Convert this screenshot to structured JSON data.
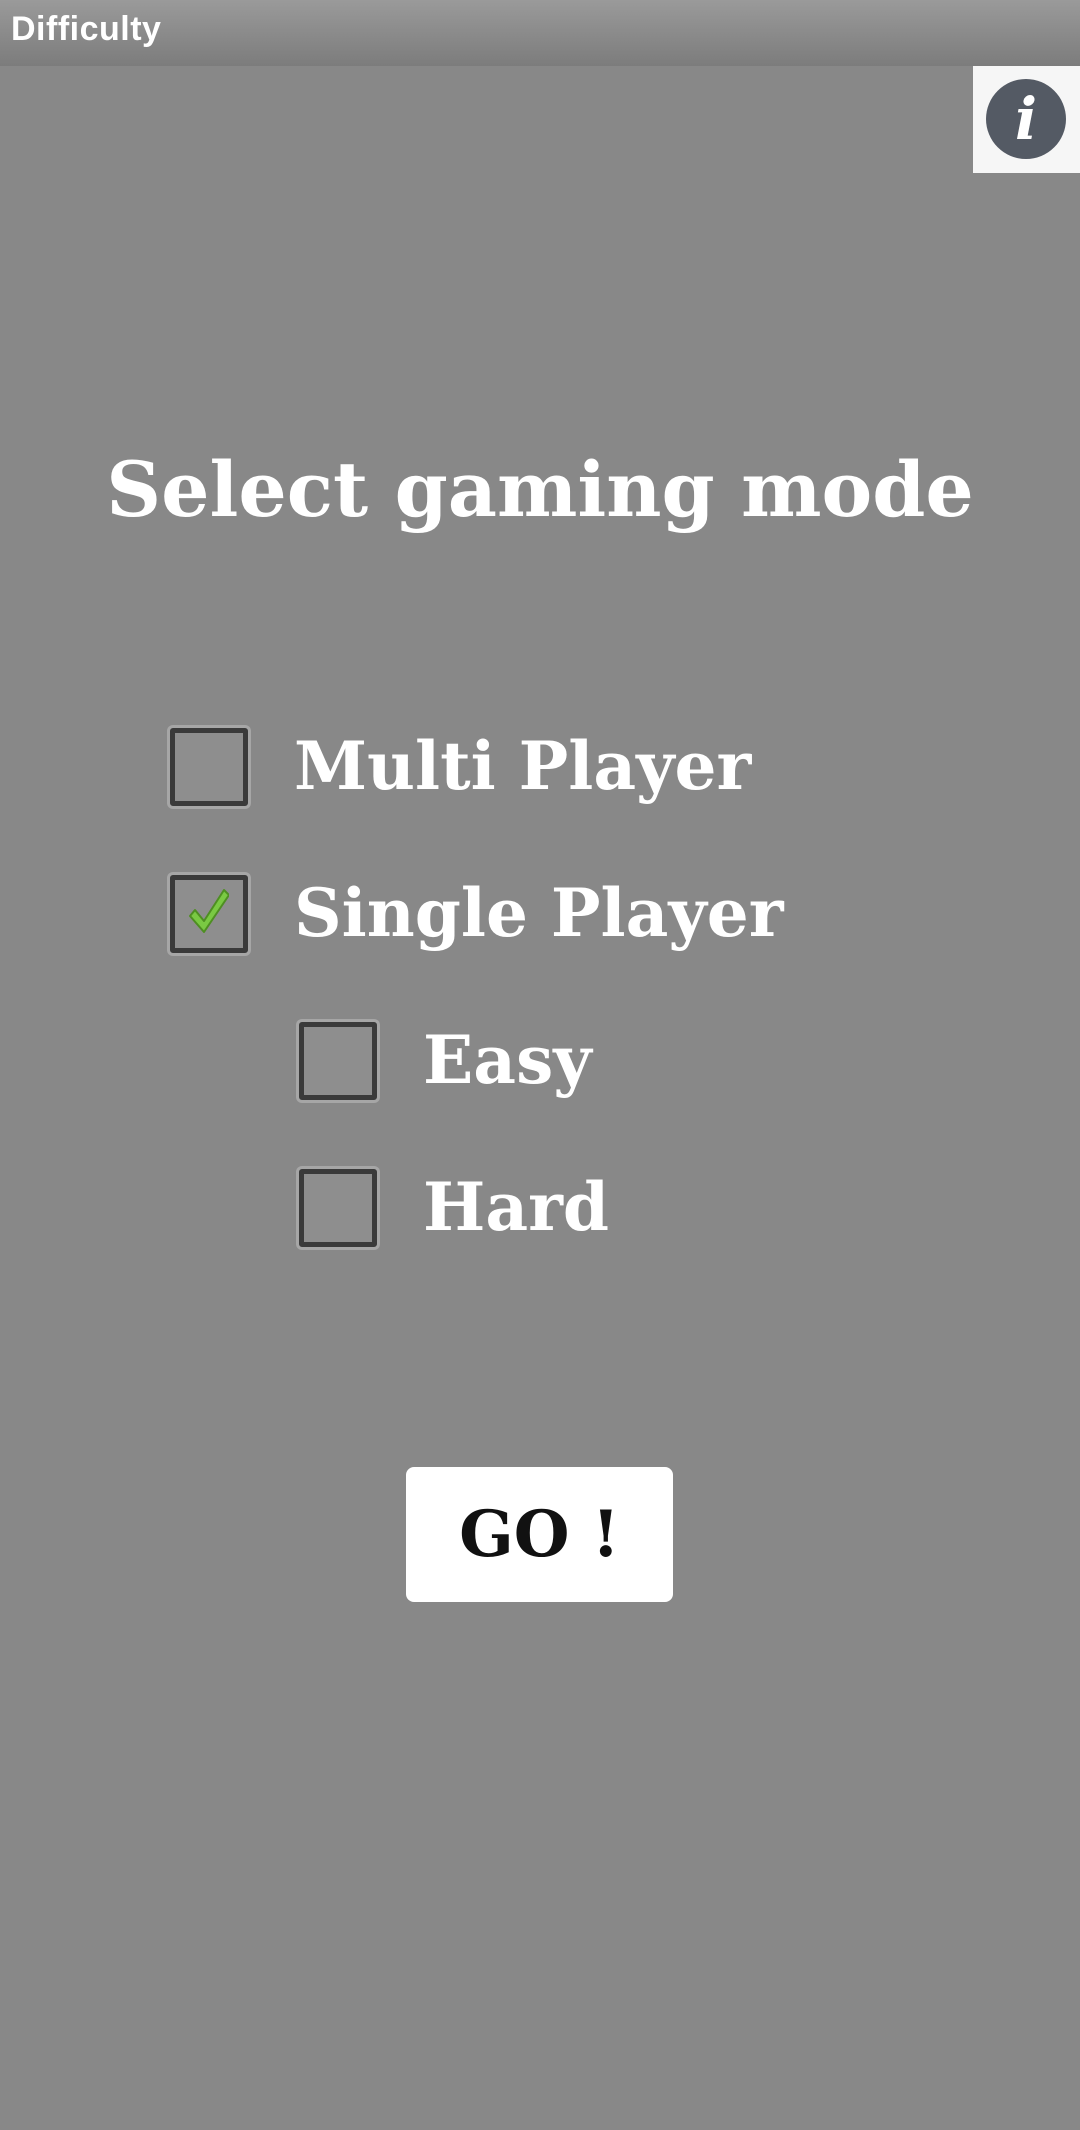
{
  "window": {
    "title": "Difficulty"
  },
  "info_button": {
    "icon": "info-icon",
    "glyph": "i"
  },
  "heading": "Select gaming mode",
  "mode_options": [
    {
      "label": "Multi Player",
      "checked": false
    },
    {
      "label": "Single Player",
      "checked": true
    }
  ],
  "difficulty_options": [
    {
      "label": "Easy",
      "checked": false
    },
    {
      "label": "Hard",
      "checked": false
    }
  ],
  "go_button": {
    "label": "GO !"
  },
  "colors": {
    "background": "#888888",
    "text": "#ffffff",
    "check_mark": "#7ac943",
    "info_circle": "#545a64"
  }
}
